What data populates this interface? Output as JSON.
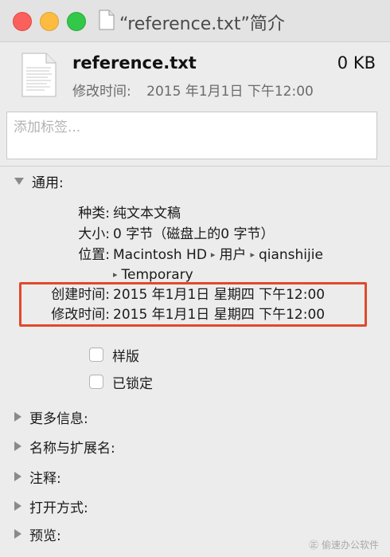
{
  "window": {
    "title": "“reference.txt”简介",
    "icon": "document-icon"
  },
  "header": {
    "file_name": "reference.txt",
    "file_size": "0 KB",
    "modified_label": "修改时间:",
    "modified_value": "2015 年1月1日 下午12:00"
  },
  "tags": {
    "placeholder": "添加标签...",
    "value": ""
  },
  "general": {
    "section_label": "通用:",
    "kind_label": "种类:",
    "kind_value": "纯文本文稿",
    "size_label": "大小:",
    "size_value": "0 字节（磁盘上的0 字节）",
    "where_label": "位置:",
    "where_path": [
      "Macintosh HD",
      "用户",
      "qianshijie",
      "Temporary"
    ],
    "created_label": "创建时间:",
    "created_value": "2015 年1月1日 星期四 下午12:00",
    "modified_label": "修改时间:",
    "modified_value": "2015 年1月1日 星期四 下午12:00",
    "stationery_label": "样版",
    "locked_label": "已锁定"
  },
  "sections": {
    "more_info": "更多信息:",
    "name_ext": "名称与扩展名:",
    "comments": "注释:",
    "open_with": "打开方式:",
    "preview": "预览:"
  },
  "watermark": "㊣ 偷速办公软件",
  "colors": {
    "highlight": "#e04a2c",
    "close": "#fc605c",
    "minimize": "#fdbc40",
    "zoom": "#34c84a"
  }
}
